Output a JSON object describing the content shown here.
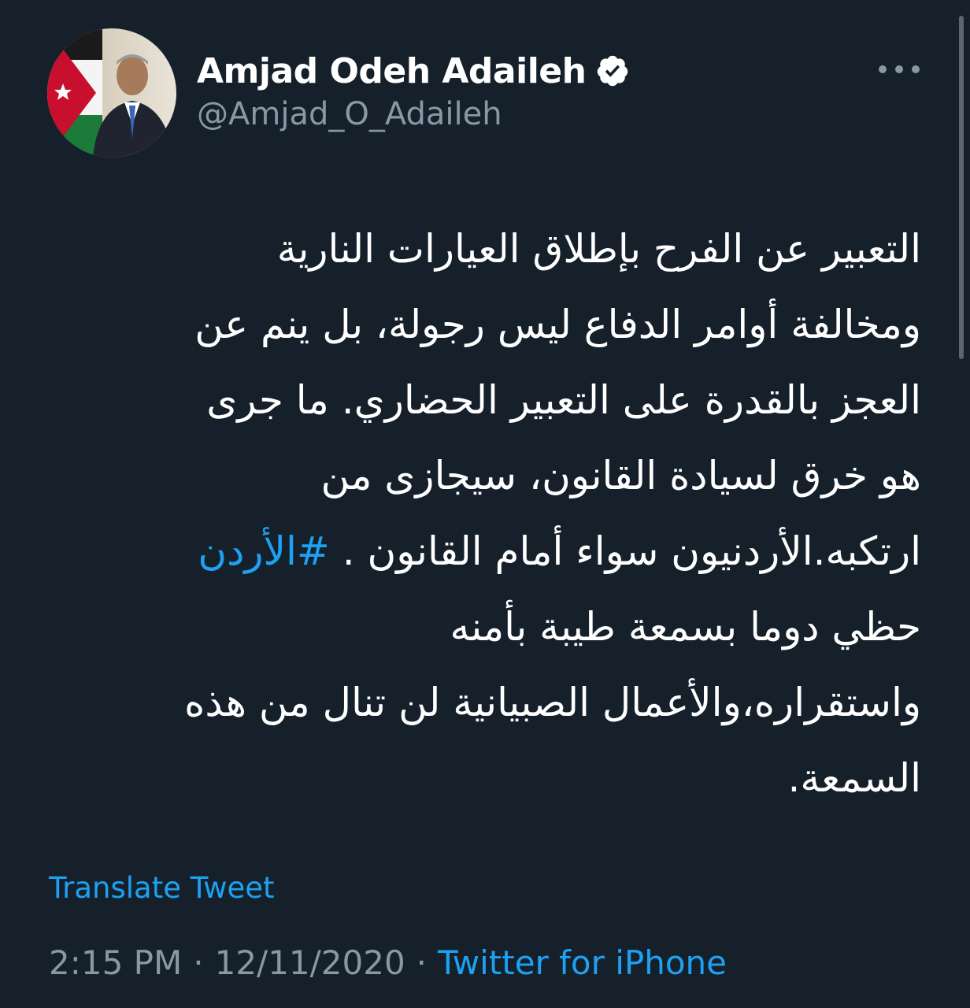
{
  "user": {
    "display_name": "Amjad Odeh Adaileh",
    "handle": "@Amjad_O_Adaileh",
    "verified": true
  },
  "tweet": {
    "lines": [
      "التعبير عن الفرح بإطلاق العيارات النارية",
      "ومخالفة أوامر الدفاع ليس رجولة، بل ينم عن",
      "العجز بالقدرة على التعبير الحضاري. ما جرى",
      "هو خرق لسيادة القانون، سيجازى من",
      "ارتكبه.الأردنيون سواء أمام القانون .",
      "حظي دوما بسمعة طيبة بأمنه",
      "واستقراره،والأعمال الصبيانية لن تنال من هذه",
      "السمعة."
    ],
    "hashtag": "#الأردن"
  },
  "translate_label": "Translate Tweet",
  "meta": {
    "time": "2:15 PM",
    "separator": "·",
    "date": "12/11/2020",
    "source": "Twitter for iPhone"
  },
  "colors": {
    "background": "#15202b",
    "text": "#ffffff",
    "secondary": "#8899a6",
    "accent": "#1da1f2"
  },
  "icons": {
    "verified": "verified-badge-icon",
    "more": "more-options-icon"
  }
}
